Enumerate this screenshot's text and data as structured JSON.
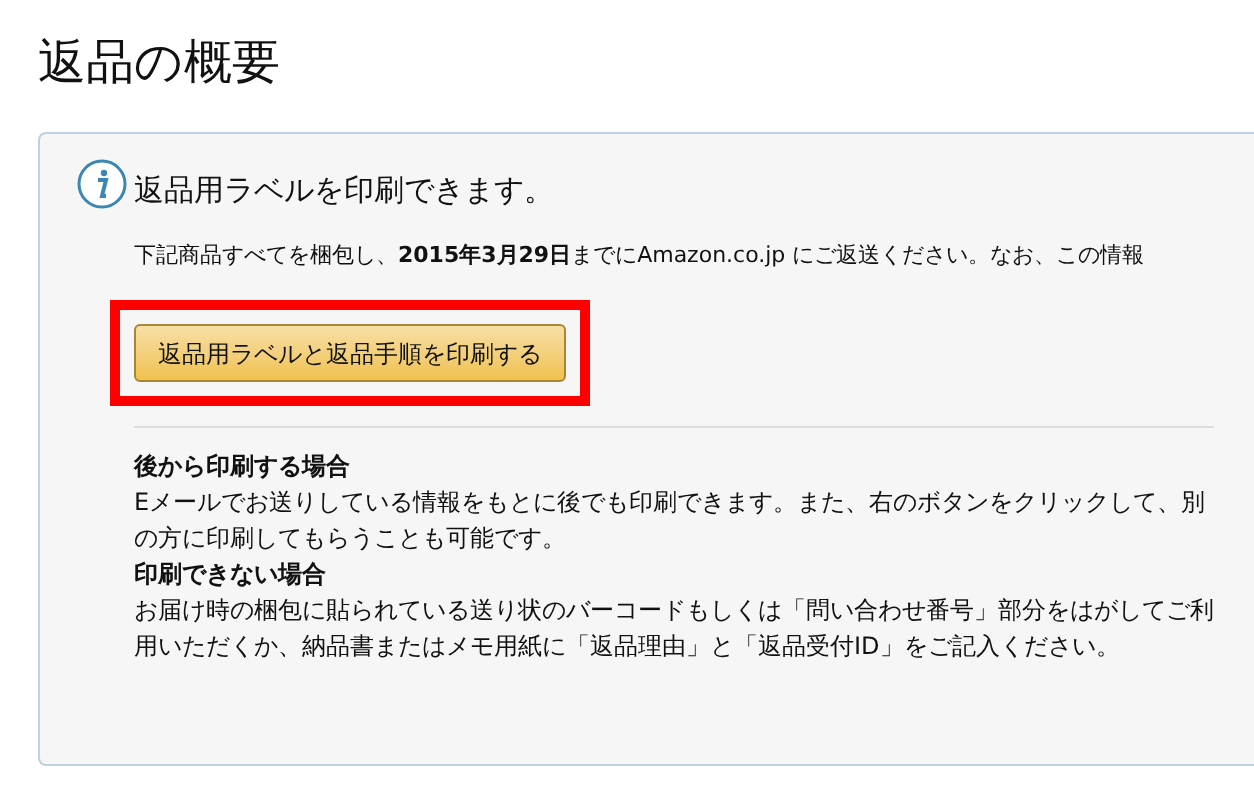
{
  "title": "返品の概要",
  "notice": {
    "heading": "返品用ラベルを印刷できます。",
    "body": "下記商品すべてを梱包し、**2015年3月29日**までにAmazon.co.jp にご返送ください。なお、この情報",
    "button": "返品用ラベルと返品手順を印刷する",
    "highlighted": true
  },
  "sections": [
    {
      "heading": "後から印刷する場合",
      "text": "Eメールでお送りしている情報をもとに後でも印刷できます。また、右のボタンをクリックして、別の方に印刷してもらうことも可能です。"
    },
    {
      "heading": "印刷できない場合",
      "text": "お届け時の梱包に貼られている送り状のバーコードもしくは「問い合わせ番号」部分をはがしてご利用いただくか、納品書またはメモ用紙に「返品理由」と「返品受付ID」をご記入ください。"
    }
  ]
}
